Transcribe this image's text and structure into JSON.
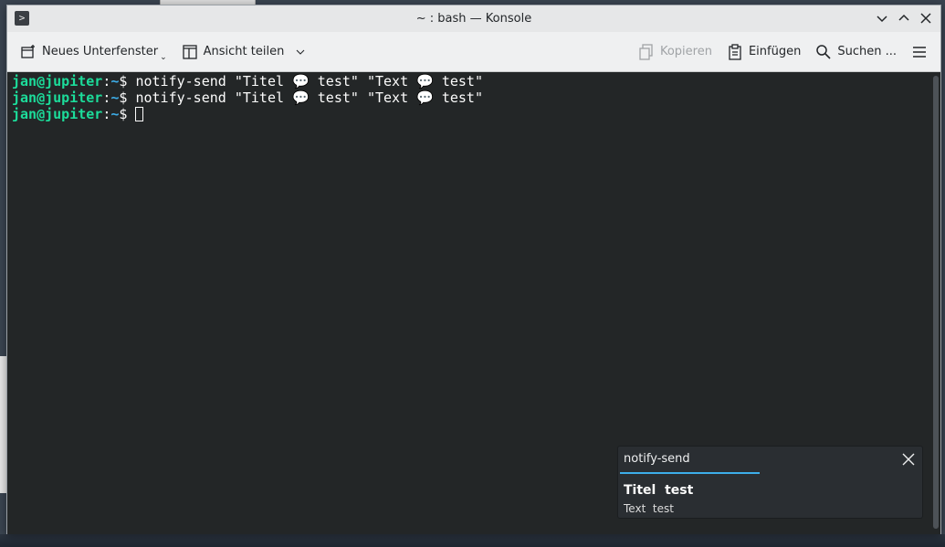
{
  "window": {
    "title": "~ : bash — Konsole"
  },
  "toolbar": {
    "new_tab_label": "Neues Unterfenster",
    "split_view_label": "Ansicht teilen",
    "copy_label": "Kopieren",
    "paste_label": "Einfügen",
    "search_label": "Suchen ..."
  },
  "terminal": {
    "lines": [
      {
        "user": "jan@jupiter",
        "sep": ":",
        "path": "~",
        "dollar": "$ ",
        "cmd": "notify-send \"Titel 💬 test\" \"Text 💬 test\""
      },
      {
        "user": "jan@jupiter",
        "sep": ":",
        "path": "~",
        "dollar": "$ ",
        "cmd": "notify-send \"Titel 💬 test\" \"Text 💬 test\""
      },
      {
        "user": "jan@jupiter",
        "sep": ":",
        "path": "~",
        "dollar": "$ ",
        "cmd": ""
      }
    ]
  },
  "notification": {
    "app_name": "notify-send",
    "title": "Titel 󠀠 test",
    "body": "Text 󠀠 test"
  },
  "colors": {
    "terminal_bg": "#232627",
    "prompt_user": "#1cdc9a",
    "prompt_path": "#3daee9",
    "accent": "#3daee9"
  }
}
